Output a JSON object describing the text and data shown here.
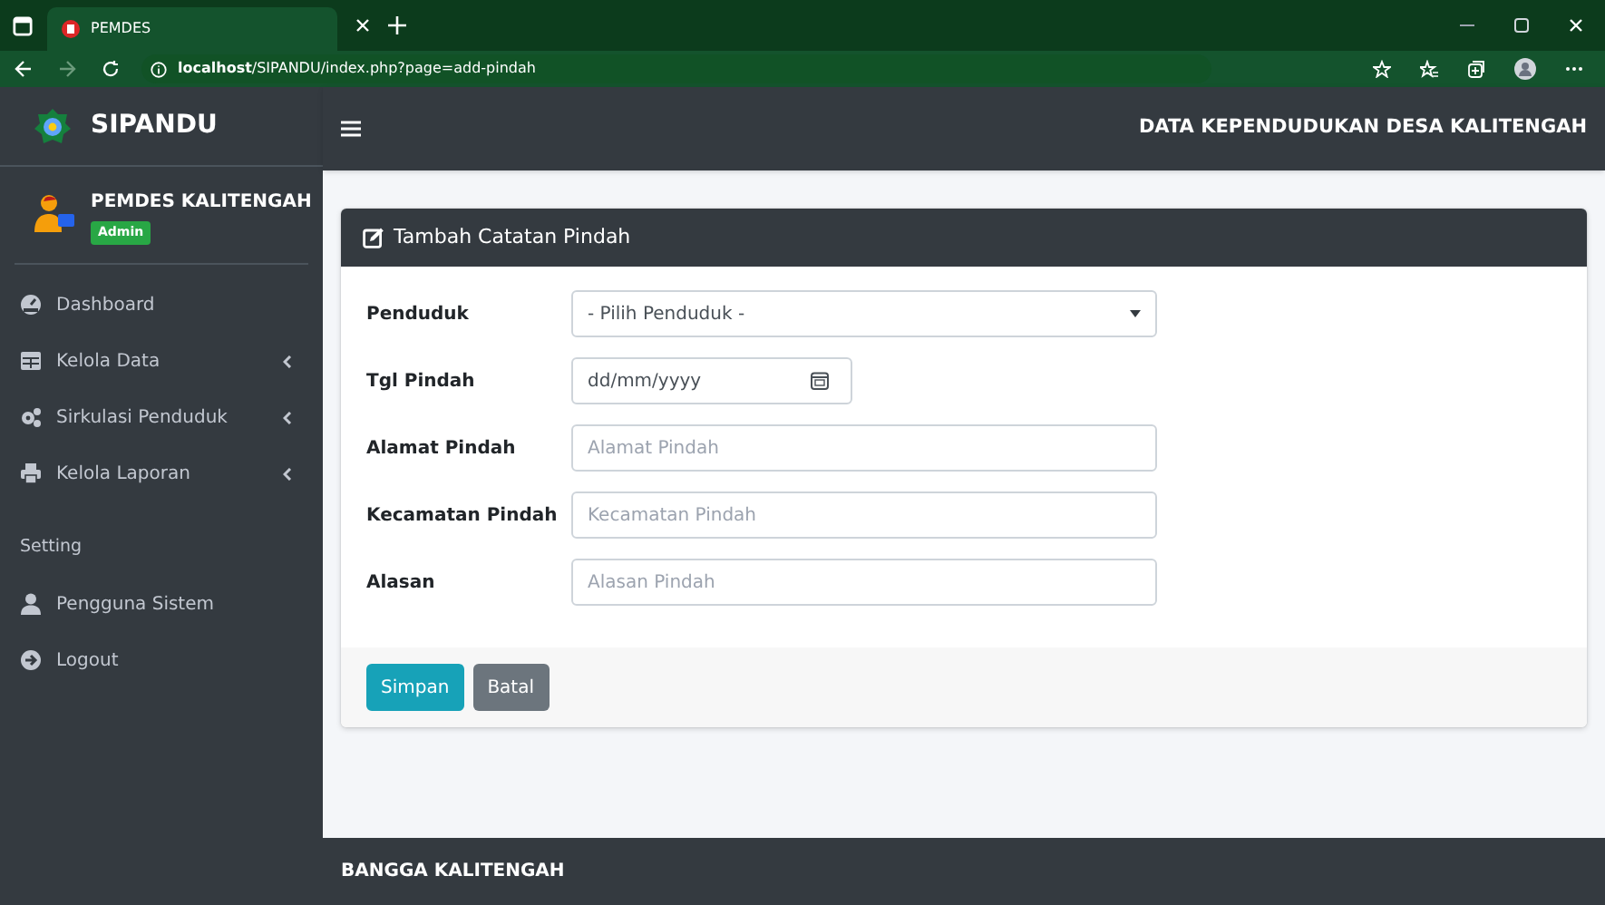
{
  "browser": {
    "tab_title": "PEMDES",
    "url": "**localhost**/SIPANDU/index.php?page=add-pindah"
  },
  "sidebar": {
    "brand": "SIPANDU",
    "user": {
      "name": "PEMDES KALITENGAH",
      "badge": "Admin"
    },
    "items": [
      {
        "kind": "link",
        "label": "Dashboard",
        "expandable": false
      },
      {
        "kind": "link",
        "label": "Kelola Data",
        "expandable": true
      },
      {
        "kind": "link",
        "label": "Sirkulasi Penduduk",
        "expandable": true
      },
      {
        "kind": "link",
        "label": "Kelola Laporan",
        "expandable": true
      },
      {
        "kind": "header",
        "label": "Setting"
      },
      {
        "kind": "link",
        "label": "Pengguna Sistem",
        "expandable": false
      },
      {
        "kind": "link",
        "label": "Logout",
        "expandable": false
      }
    ]
  },
  "navbar": {
    "title": "DATA KEPENDUDUKAN DESA KALITENGAH"
  },
  "card": {
    "title": "Tambah Catatan Pindah",
    "fields": [
      {
        "kind": "select",
        "label": "Penduduk",
        "value": "- Pilih Penduduk -"
      },
      {
        "kind": "date",
        "label": "Tgl Pindah",
        "value": "dd/mm/yyyy"
      },
      {
        "kind": "text",
        "label": "Alamat Pindah",
        "placeholder": "Alamat Pindah"
      },
      {
        "kind": "text",
        "label": "Kecamatan Pindah",
        "placeholder": "Kecamatan Pindah"
      },
      {
        "kind": "text",
        "label": "Alasan",
        "placeholder": "Alasan Pindah"
      }
    ],
    "buttons": [
      {
        "kind": "primary",
        "label": "Simpan"
      },
      {
        "kind": "secondary",
        "label": "Batal"
      }
    ]
  },
  "footer": {
    "text": "BANGGA KALITENGAH"
  }
}
